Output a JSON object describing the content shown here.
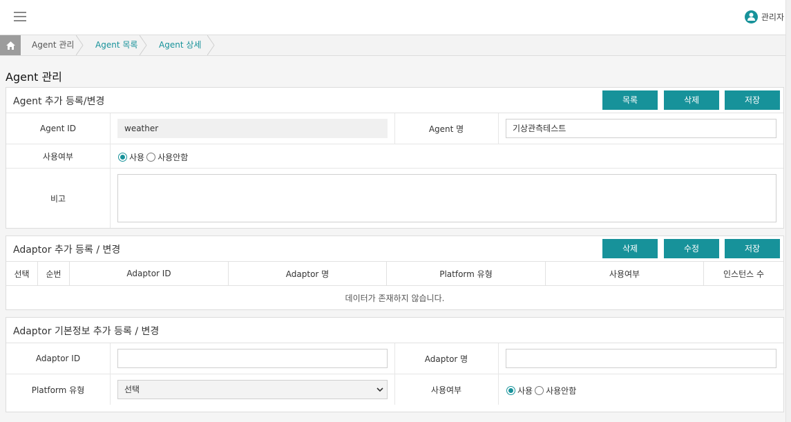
{
  "header": {
    "user_name": "관리자"
  },
  "breadcrumb": [
    "Agent 관리",
    "Agent 목록",
    "Agent 상세"
  ],
  "page_title": "Agent 관리",
  "agent_panel": {
    "title": "Agent 추가 등록/변경",
    "buttons": {
      "list": "목록",
      "delete": "삭제",
      "save": "저장"
    },
    "agent_id_label": "Agent ID",
    "agent_id_value": "weather",
    "agent_name_label": "Agent 명",
    "agent_name_value": "기상관측테스트",
    "use_label": "사용여부",
    "use_yes": "사용",
    "use_no": "사용안함",
    "note_label": "비고"
  },
  "adaptor_panel": {
    "title": "Adaptor 추가 등록 / 변경",
    "buttons": {
      "delete": "삭제",
      "edit": "수정",
      "save": "저장"
    },
    "columns": [
      "선택",
      "순번",
      "Adaptor ID",
      "Adaptor 명",
      "Platform 유형",
      "사용여부",
      "인스턴스 수"
    ],
    "empty_message": "데이터가 존재하지 않습니다."
  },
  "adaptor_info_panel": {
    "title": "Adaptor 기본정보 추가 등록 / 변경",
    "adaptor_id_label": "Adaptor ID",
    "adaptor_id_value": "",
    "adaptor_name_label": "Adaptor 명",
    "adaptor_name_value": "",
    "platform_label": "Platform 유형",
    "platform_selected": "선택",
    "use_label": "사용여부",
    "use_yes": "사용",
    "use_no": "사용안함"
  },
  "colors": {
    "accent": "#17929a",
    "breadcrumb_home": "#9c9c9c"
  }
}
